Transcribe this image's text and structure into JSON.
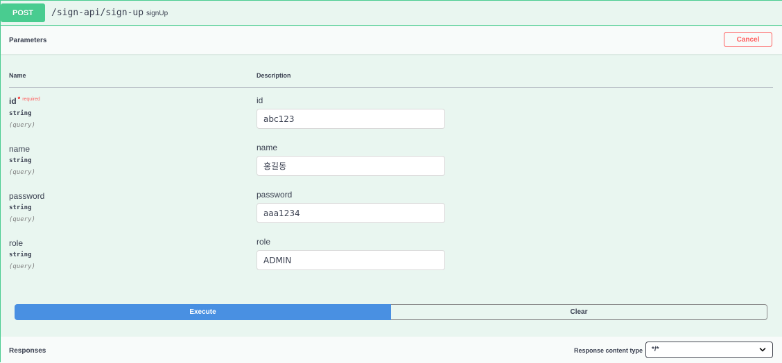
{
  "operation": {
    "method": "POST",
    "path": "/sign-api/sign-up",
    "summary": "signUp"
  },
  "parameters_section": {
    "title": "Parameters",
    "cancel_label": "Cancel",
    "col_name": "Name",
    "col_description": "Description"
  },
  "params": [
    {
      "name": "id",
      "required_marker": "*",
      "required_label": "required",
      "type": "string",
      "in": "(query)",
      "description": "id",
      "value": "abc123"
    },
    {
      "name": "name",
      "type": "string",
      "in": "(query)",
      "description": "name",
      "value": "홍길동"
    },
    {
      "name": "password",
      "type": "string",
      "in": "(query)",
      "description": "password",
      "value": "aaa1234"
    },
    {
      "name": "role",
      "type": "string",
      "in": "(query)",
      "description": "role",
      "value": "ADMIN"
    }
  ],
  "actions": {
    "execute_label": "Execute",
    "clear_label": "Clear"
  },
  "responses": {
    "title": "Responses",
    "content_type_label": "Response content type",
    "content_type_value": "*/*"
  },
  "colors": {
    "post_green": "#49cc90",
    "execute_blue": "#4990e2",
    "cancel_red": "#ff6060"
  },
  "icons": {
    "select_arrow": "chevron-down-icon"
  }
}
